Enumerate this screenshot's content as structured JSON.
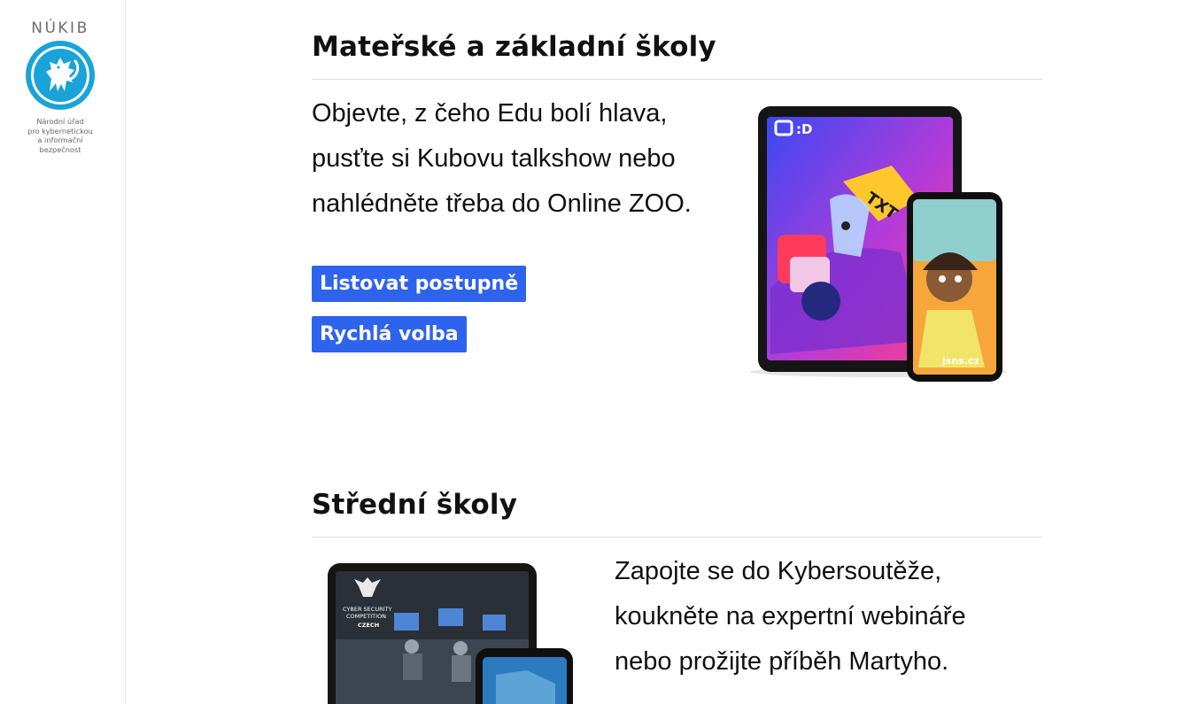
{
  "brand": {
    "wordmark": "NÚKIB",
    "subtitle_lines": [
      "Národní úřad",
      "pro kybernetickou",
      "a informační",
      "bezpečnost"
    ],
    "accent_color": "#1aa3d9"
  },
  "sections": [
    {
      "title": "Mateřské a základní školy",
      "lead_lines": [
        "Objevte, z čeho Edu bolí hlava,",
        "pusťte si Kubovu talkshow nebo",
        "nahlédněte třeba do Online ZOO."
      ],
      "buttons": [
        "Listovat postupně",
        "Rychlá volba"
      ],
      "image": {
        "tablet_badge": "◘:D",
        "sticker": "TXT",
        "phone_caption": "jsns.cz"
      }
    },
    {
      "title": "Střední školy",
      "lead_lines": [
        "Zapojte se do Kybersoutěže,",
        "koukněte na expertní webináře",
        "nebo prožijte příběh Martyho."
      ],
      "image": {
        "logo_lines": [
          "CYBER SECURITY",
          "COMPETITION",
          "CZECH"
        ]
      }
    }
  ],
  "colors": {
    "button_bg": "#2e63ee",
    "button_text": "#ffffff"
  }
}
